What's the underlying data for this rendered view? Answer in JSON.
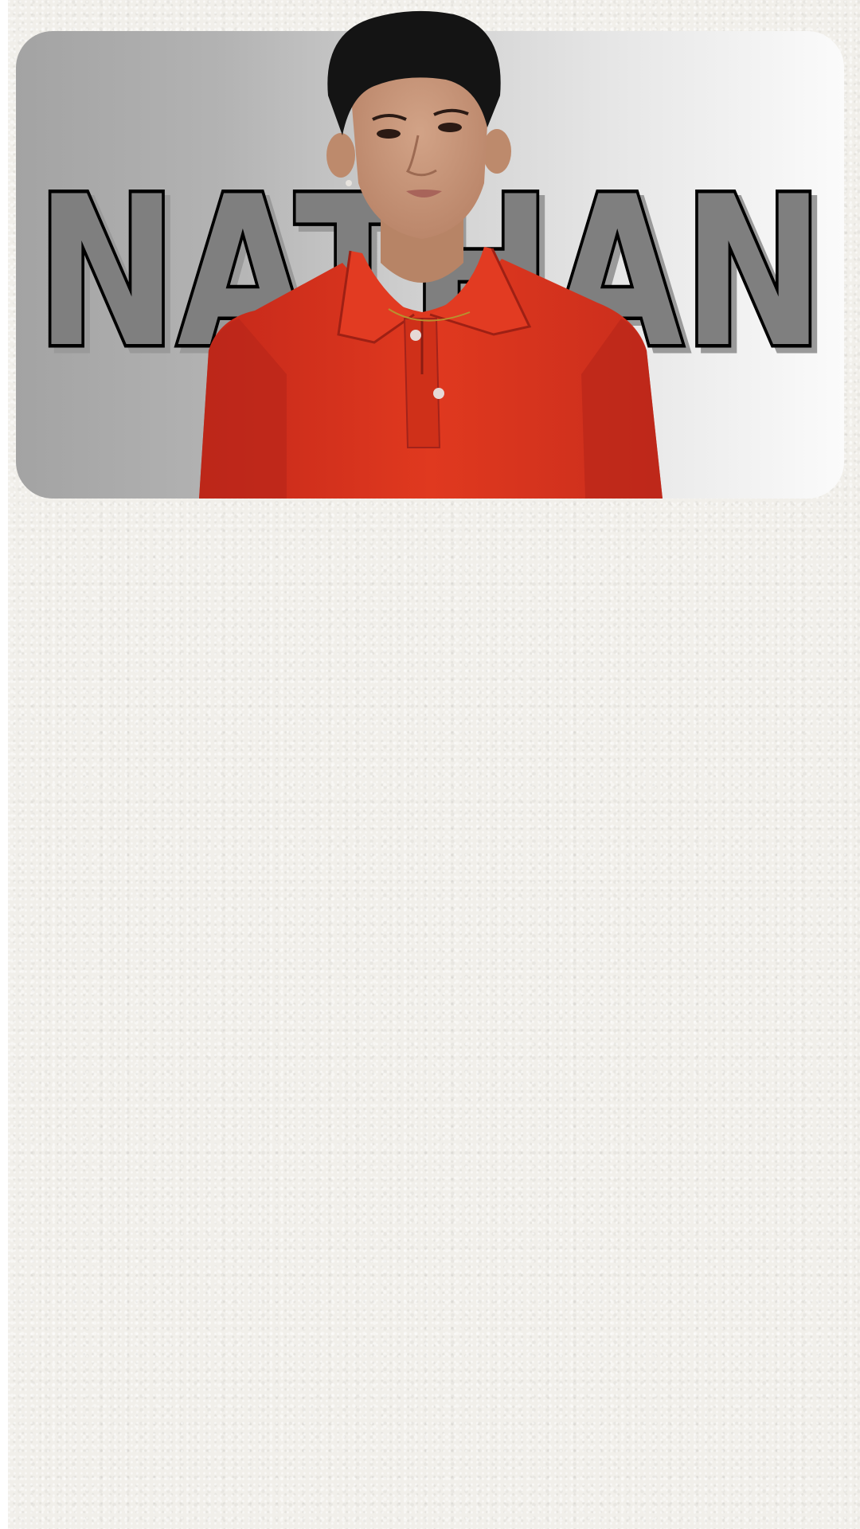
{
  "hero": {
    "name": "NATHAN",
    "colors": {
      "name_fill": "#7f7f7f",
      "name_stroke": "#000000",
      "shirt": "#d93220",
      "hair": "#141414",
      "skin": "#c99a7f"
    }
  },
  "icons": {
    "portrait": "person-portrait-photo"
  }
}
